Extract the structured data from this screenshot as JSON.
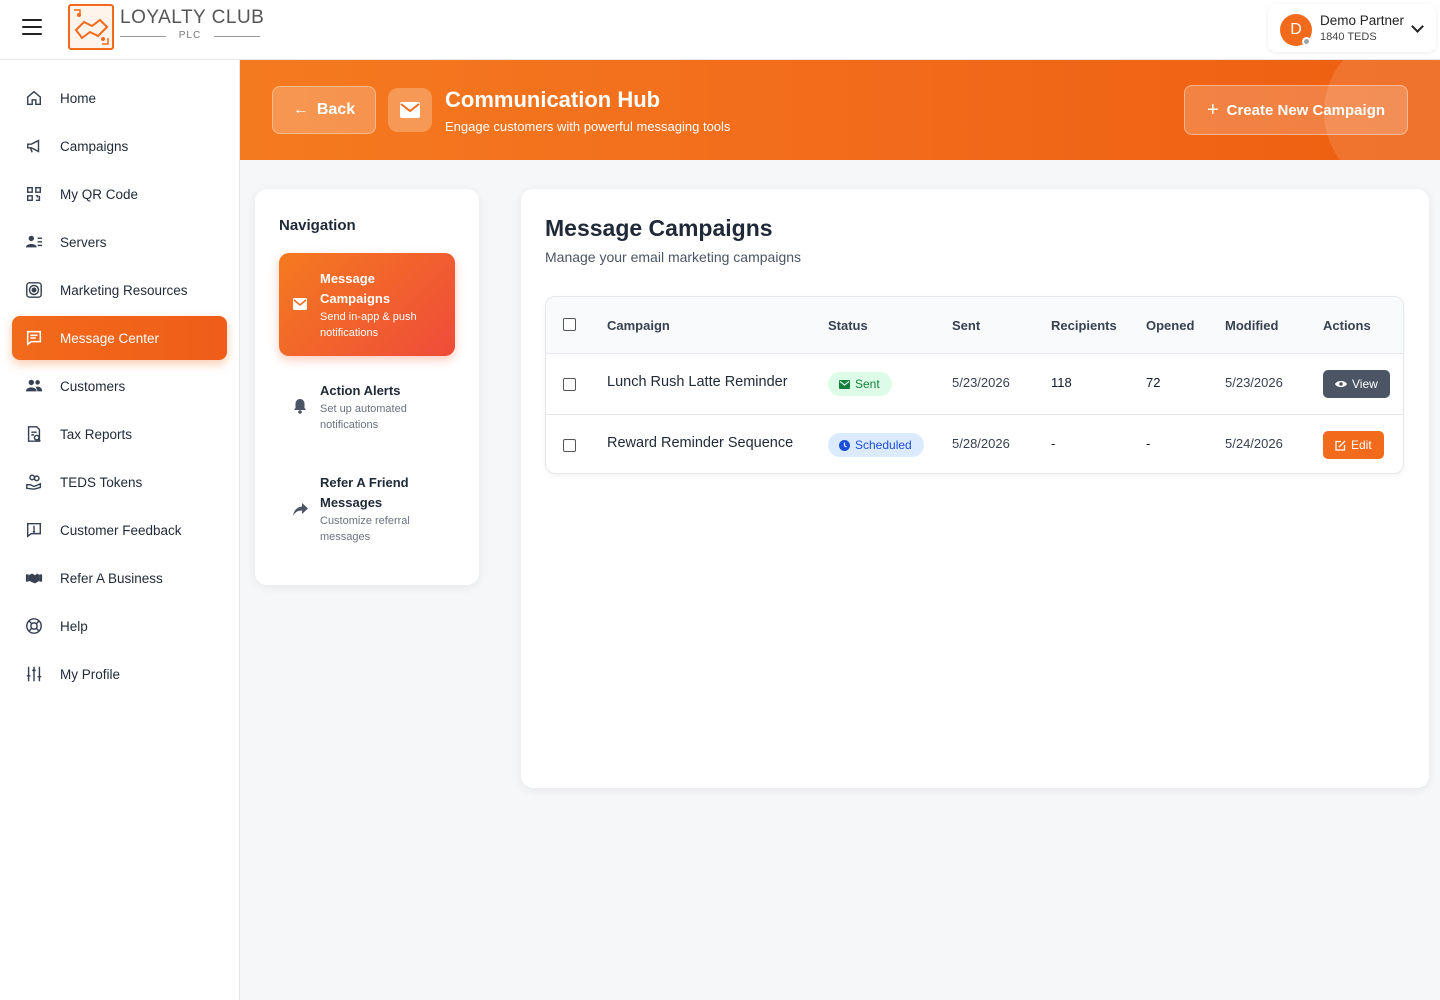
{
  "brand": {
    "name": "LOYALTY CLUB",
    "sub": "PLC"
  },
  "user": {
    "initial": "D",
    "name": "Demo Partner",
    "balance": "1840 TEDS"
  },
  "sidebar": {
    "items": [
      {
        "label": "Home",
        "icon": "home-icon",
        "active": false
      },
      {
        "label": "Campaigns",
        "icon": "megaphone-icon",
        "active": false
      },
      {
        "label": "My QR Code",
        "icon": "qr-code-icon",
        "active": false
      },
      {
        "label": "Servers",
        "icon": "user-list-icon",
        "active": false
      },
      {
        "label": "Marketing Resources",
        "icon": "target-icon",
        "active": false
      },
      {
        "label": "Message Center",
        "icon": "message-icon",
        "active": true
      },
      {
        "label": "Customers",
        "icon": "users-icon",
        "active": false
      },
      {
        "label": "Tax Reports",
        "icon": "tax-report-icon",
        "active": false
      },
      {
        "label": "TEDS Tokens",
        "icon": "tokens-icon",
        "active": false
      },
      {
        "label": "Customer Feedback",
        "icon": "feedback-icon",
        "active": false
      },
      {
        "label": "Refer A Business",
        "icon": "handshake-icon",
        "active": false
      },
      {
        "label": "Help",
        "icon": "lifebuoy-icon",
        "active": false
      },
      {
        "label": "My Profile",
        "icon": "sliders-icon",
        "active": false
      }
    ]
  },
  "hero": {
    "back_label": "Back",
    "title": "Communication Hub",
    "subtitle": "Engage customers with powerful messaging tools",
    "create_label": "Create New Campaign"
  },
  "navcard": {
    "title": "Navigation",
    "items": [
      {
        "title": "Message Campaigns",
        "desc": "Send in-app & push notifications",
        "icon": "envelope-icon",
        "active": true
      },
      {
        "title": "Action Alerts",
        "desc": "Set up automated notifications",
        "icon": "bell-icon",
        "active": false
      },
      {
        "title": "Refer A Friend Messages",
        "desc": "Customize referral messages",
        "icon": "share-arrow-icon",
        "active": false
      }
    ]
  },
  "main": {
    "title": "Message Campaigns",
    "subtitle": "Manage your email marketing campaigns",
    "columns": [
      "Campaign",
      "Status",
      "Sent",
      "Recipients",
      "Opened",
      "Modified",
      "Actions"
    ],
    "rows": [
      {
        "campaign": "Lunch Rush Latte Reminder",
        "status": "Sent",
        "sent": "5/23/2026",
        "recipients": "118",
        "opened": "72",
        "modified": "5/23/2026",
        "action": "View"
      },
      {
        "campaign": "Reward Reminder Sequence",
        "status": "Scheduled",
        "sent": "5/28/2026",
        "recipients": "-",
        "opened": "-",
        "modified": "5/24/2026",
        "action": "Edit"
      }
    ]
  },
  "colors": {
    "accent": "#f26a1b",
    "sent_badge": "#dcfce7",
    "scheduled_badge": "#dbeafe",
    "view_button": "#4b5563"
  }
}
